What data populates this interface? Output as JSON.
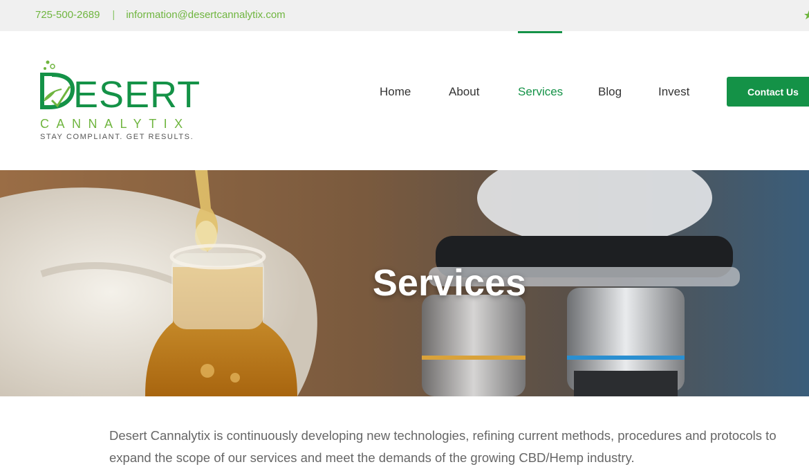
{
  "topbar": {
    "phone": "725-500-2689",
    "separator": "|",
    "email": "information@desertcannalytix.com"
  },
  "logo": {
    "word": "ESERT",
    "subtitle": "CANNALYTIX",
    "tagline": "STAY COMPLIANT. GET RESULTS."
  },
  "nav": {
    "items": [
      {
        "label": "Home"
      },
      {
        "label": "About"
      },
      {
        "label": "Services"
      },
      {
        "label": "Blog"
      },
      {
        "label": "Invest"
      }
    ],
    "active": "Services",
    "contact_button": "Contact Us"
  },
  "hero": {
    "title": "Services"
  },
  "content": {
    "intro": "Desert Cannalytix is continuously developing new technologies, refining current methods, procedures and protocols to expand the scope of our services and meet the demands of the growing CBD/Hemp industry."
  },
  "colors": {
    "brand_green": "#149247",
    "accent_green": "#6fb53f",
    "topbar_bg": "#f0f0f0"
  }
}
